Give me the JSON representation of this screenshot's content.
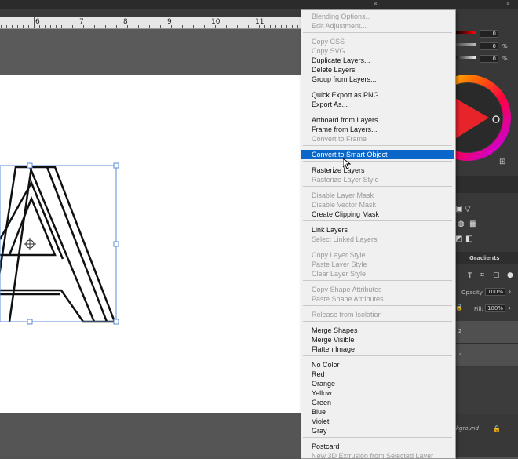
{
  "ruler": {
    "labels": [
      "6",
      "7",
      "8",
      "9",
      "10",
      "11"
    ]
  },
  "context_menu": {
    "items": [
      {
        "label": "Blending Options...",
        "enabled": false
      },
      {
        "label": "Edit Adjustment...",
        "enabled": false
      },
      {
        "label": "Copy CSS",
        "enabled": false
      },
      {
        "label": "Copy SVG",
        "enabled": false
      },
      {
        "label": "Duplicate Layers...",
        "enabled": true
      },
      {
        "label": "Delete Layers",
        "enabled": true
      },
      {
        "label": "Group from Layers...",
        "enabled": true
      },
      {
        "label": "Quick Export as PNG",
        "enabled": true
      },
      {
        "label": "Export As...",
        "enabled": true
      },
      {
        "label": "Artboard from Layers...",
        "enabled": true
      },
      {
        "label": "Frame from Layers...",
        "enabled": true
      },
      {
        "label": "Convert to Frame",
        "enabled": false
      },
      {
        "label": "Convert to Smart Object",
        "enabled": true,
        "highlighted": true
      },
      {
        "label": "Rasterize Layers",
        "enabled": true
      },
      {
        "label": "Rasterize Layer Style",
        "enabled": false
      },
      {
        "label": "Disable Layer Mask",
        "enabled": false
      },
      {
        "label": "Disable Vector Mask",
        "enabled": false
      },
      {
        "label": "Create Clipping Mask",
        "enabled": true
      },
      {
        "label": "Link Layers",
        "enabled": true
      },
      {
        "label": "Select Linked Layers",
        "enabled": false
      },
      {
        "label": "Copy Layer Style",
        "enabled": false
      },
      {
        "label": "Paste Layer Style",
        "enabled": false
      },
      {
        "label": "Clear Layer Style",
        "enabled": false
      },
      {
        "label": "Copy Shape Attributes",
        "enabled": false
      },
      {
        "label": "Paste Shape Attributes",
        "enabled": false
      },
      {
        "label": "Release from Isolation",
        "enabled": false
      },
      {
        "label": "Merge Shapes",
        "enabled": true
      },
      {
        "label": "Merge Visible",
        "enabled": true
      },
      {
        "label": "Flatten Image",
        "enabled": true
      },
      {
        "label": "No Color",
        "enabled": true
      },
      {
        "label": "Red",
        "enabled": true
      },
      {
        "label": "Orange",
        "enabled": true
      },
      {
        "label": "Yellow",
        "enabled": true
      },
      {
        "label": "Green",
        "enabled": true
      },
      {
        "label": "Blue",
        "enabled": true
      },
      {
        "label": "Violet",
        "enabled": true
      },
      {
        "label": "Gray",
        "enabled": true
      },
      {
        "label": "Postcard",
        "enabled": true
      },
      {
        "label": "New 3D Extrusion from Selected Layer",
        "enabled": false
      }
    ]
  },
  "color_panel": {
    "values": [
      "0",
      "0",
      "0"
    ],
    "units": [
      "",
      "%",
      "%"
    ]
  },
  "layers_panel": {
    "tab_gradients": "Gradients",
    "opacity_label": "Opacity:",
    "opacity_value": "100%",
    "fill_label": "Fill:",
    "fill_value": "100%",
    "row_labels": [
      "2",
      "2"
    ],
    "background_label": "Background"
  },
  "colors": {
    "highlight": "#0a67c9",
    "menu_bg": "#f0f0f0",
    "panel_bg": "#383838"
  }
}
